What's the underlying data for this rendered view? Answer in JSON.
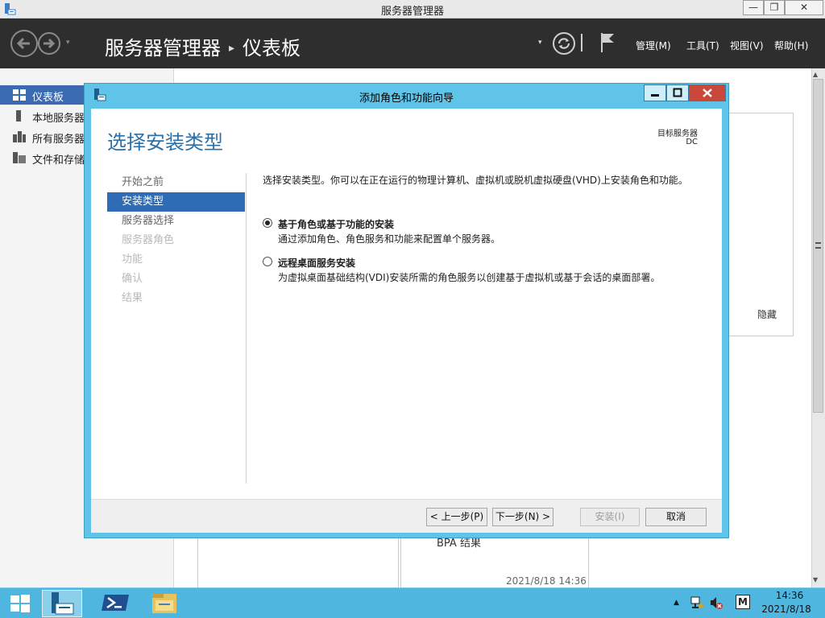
{
  "window": {
    "title": "服务器管理器",
    "min_label": "—",
    "max_label": "❐",
    "close_label": "✕"
  },
  "header": {
    "breadcrumb_root": "服务器管理器",
    "breadcrumb_sep": "▸",
    "breadcrumb_page": "仪表板",
    "dropdown_glyph": "▾",
    "menus": {
      "manage": "管理(M)",
      "tools": "工具(T)",
      "view": "视图(V)",
      "help": "帮助(H)"
    }
  },
  "nav": {
    "items": [
      {
        "label": "仪表板",
        "icon": "dashboard-icon",
        "active": true
      },
      {
        "label": "本地服务器",
        "icon": "local-server-icon"
      },
      {
        "label": "所有服务器",
        "icon": "all-servers-icon"
      },
      {
        "label": "文件和存储服务",
        "icon": "file-storage-icon"
      }
    ]
  },
  "background": {
    "hide_label": "隐藏",
    "bpa_label": "BPA 结果",
    "date_label": "2021/8/18 14:36"
  },
  "wizard": {
    "title": "添加角色和功能向导",
    "heading": "选择安装类型",
    "target_label": "目标服务器",
    "target_value": "DC",
    "steps": [
      {
        "label": "开始之前",
        "state": "normal"
      },
      {
        "label": "安装类型",
        "state": "active"
      },
      {
        "label": "服务器选择",
        "state": "normal"
      },
      {
        "label": "服务器角色",
        "state": "disabled"
      },
      {
        "label": "功能",
        "state": "disabled"
      },
      {
        "label": "确认",
        "state": "disabled"
      },
      {
        "label": "结果",
        "state": "disabled"
      }
    ],
    "intro": "选择安装类型。你可以在正在运行的物理计算机、虚拟机或脱机虚拟硬盘(VHD)上安装角色和功能。",
    "options": [
      {
        "title": "基于角色或基于功能的安装",
        "desc": "通过添加角色、角色服务和功能来配置单个服务器。",
        "selected": true
      },
      {
        "title": "远程桌面服务安装",
        "desc": "为虚拟桌面基础结构(VDI)安装所需的角色服务以创建基于虚拟机或基于会话的桌面部署。",
        "selected": false
      }
    ],
    "buttons": {
      "prev": "< 上一步(P)",
      "next": "下一步(N) >",
      "install": "安装(I)",
      "cancel": "取消"
    }
  },
  "taskbar": {
    "ime": "M",
    "time": "14:36",
    "date": "2021/8/18",
    "tray_arrow": "▲"
  },
  "colors": {
    "wizard_frame": "#60c4e8",
    "accent": "#2e6cb5",
    "heading": "#2c6fa6",
    "header_bg": "#2e2e2e",
    "taskbar": "#4fb6e0"
  }
}
